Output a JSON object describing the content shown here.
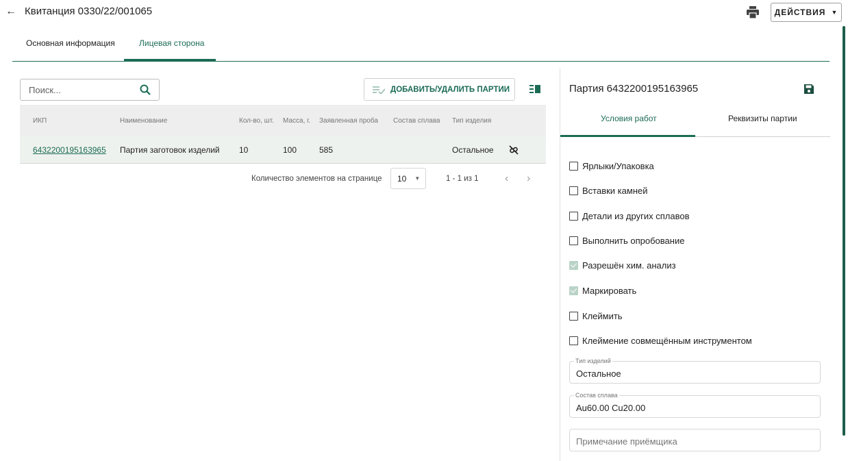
{
  "header": {
    "title": "Квитанция 0330/22/001065",
    "actions_label": "Действия"
  },
  "tabs": [
    "Основная информация",
    "Лицевая сторона"
  ],
  "search": {
    "placeholder": "Поиск..."
  },
  "toolbar": {
    "add_remove_label": "Добавить/удалить партии"
  },
  "table": {
    "columns": [
      "ИКП",
      "Наименование",
      "Кол-во, шт.",
      "Масса, г.",
      "Заявленная проба",
      "Состав сплава",
      "Тип изделия"
    ],
    "rows": [
      {
        "ikp": "6432200195163965",
        "name": "Партия заготовок изделий",
        "qty": "10",
        "mass": "100",
        "assay": "585",
        "alloy": "",
        "type": "Остальное"
      }
    ]
  },
  "pager": {
    "per_page_label": "Количество элементов на странице",
    "per_page_value": "10",
    "range": "1 - 1 из 1"
  },
  "details": {
    "title": "Партия 6432200195163965",
    "tabs": [
      "Условия работ",
      "Реквизиты партии"
    ],
    "checkboxes": [
      {
        "label": "Ярлыки/Упаковка",
        "checked": false
      },
      {
        "label": "Вставки камней",
        "checked": false
      },
      {
        "label": "Детали из других сплавов",
        "checked": false
      },
      {
        "label": "Выполнить опробование",
        "checked": false
      },
      {
        "label": "Разрешён хим. анализ",
        "checked": true
      },
      {
        "label": "Маркировать",
        "checked": true
      },
      {
        "label": "Клеймить",
        "checked": false
      },
      {
        "label": "Клеймение совмещённым инструментом",
        "checked": false
      }
    ],
    "fields": {
      "product_type": {
        "label": "Тип изделий",
        "value": "Остальное"
      },
      "alloy": {
        "label": "Состав сплава",
        "value": "Au60.00 Cu20.00"
      },
      "note": {
        "placeholder": "Примечание приёмщика"
      }
    }
  },
  "colors": {
    "accent": "#1b6b55"
  }
}
